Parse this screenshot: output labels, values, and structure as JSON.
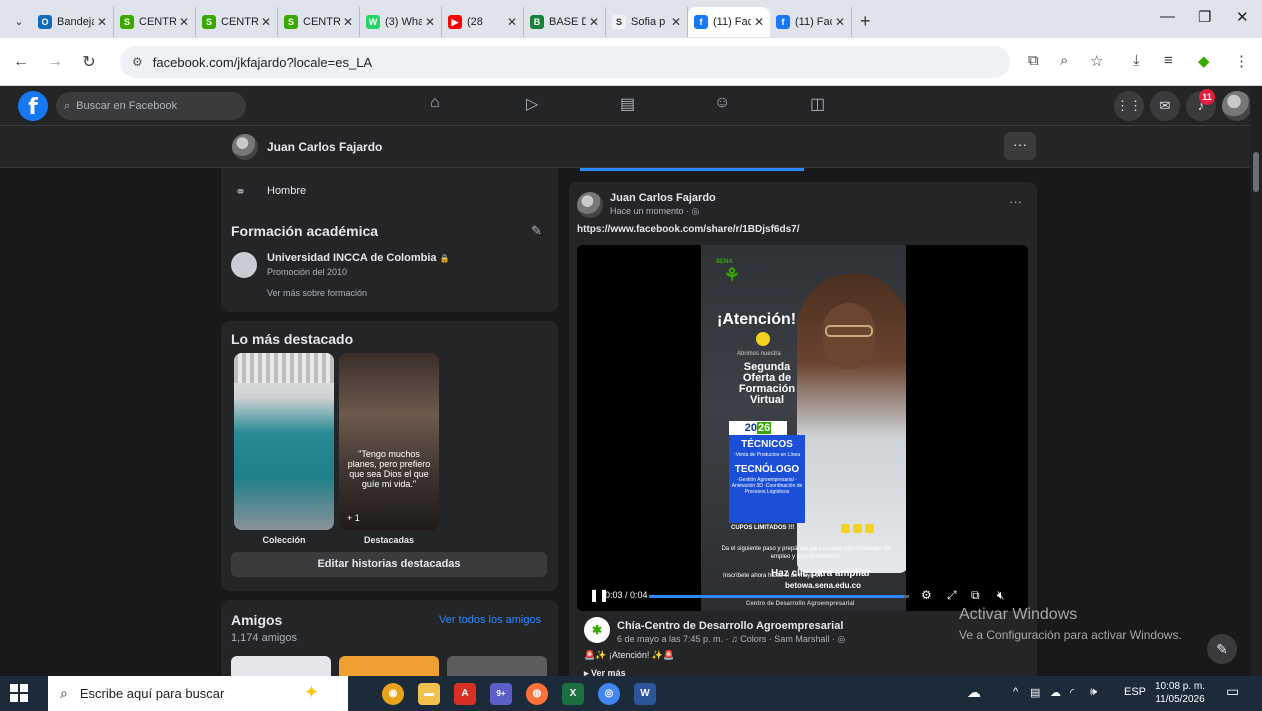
{
  "browser": {
    "tabs": [
      {
        "label": "Bandeja",
        "favicon": "outlook-icon",
        "color": "#0f6cbd",
        "glyph": "O"
      },
      {
        "label": "CENTRO",
        "favicon": "sofia-icon",
        "color": "#39a900",
        "glyph": "S"
      },
      {
        "label": "CENTRO",
        "favicon": "sofia-icon",
        "color": "#39a900",
        "glyph": "S"
      },
      {
        "label": "CENTRO",
        "favicon": "sofia-icon",
        "color": "#39a900",
        "glyph": "S"
      },
      {
        "label": "(3) Wha",
        "favicon": "whatsapp-icon",
        "color": "#25d366",
        "glyph": "W"
      },
      {
        "label": "(28",
        "favicon": "youtube-icon",
        "color": "#ff0000",
        "glyph": "▶"
      },
      {
        "label": "BASE D",
        "favicon": "sheets-icon",
        "color": "#188038",
        "glyph": "B"
      },
      {
        "label": "Sofia p",
        "favicon": "sofiaplus-icon",
        "color": "#f2f2f2",
        "glyph": "S"
      },
      {
        "label": "(11) Fac",
        "favicon": "facebook-icon",
        "color": "#1877f2",
        "glyph": "f",
        "active": true
      },
      {
        "label": "(11) Fac",
        "favicon": "facebook-icon",
        "color": "#1877f2",
        "glyph": "f"
      }
    ],
    "url": "facebook.com/jkfajardo?locale=es_LA"
  },
  "facebook": {
    "search_placeholder": "Buscar en Facebook",
    "notification_count": "11"
  },
  "profile": {
    "name": "Juan Carlos Fajardo",
    "gender": "Hombre"
  },
  "education": {
    "title": "Formación académica",
    "school": "Universidad INCCA de Colombia",
    "lock": "🔒",
    "class_of": "Promoción del 2010",
    "see_more": "Ver más sobre formación"
  },
  "highlights": {
    "title": "Lo más destacado",
    "items": [
      {
        "label": "Colección"
      },
      {
        "label": "Destacadas",
        "quote": "\"Tengo muchos planes, pero prefiero que sea Dios el que guíe mi vida.\"",
        "extra": "+ 1"
      }
    ],
    "edit_button": "Editar historias destacadas"
  },
  "friends": {
    "title": "Amigos",
    "count": "1,174 amigos",
    "see_all": "Ver todos los amigos"
  },
  "post": {
    "author": "Juan Carlos Fajardo",
    "time": "Hace un momento · ",
    "link": "https://www.facebook.com/share/r/1BDjsf6ds7/",
    "video": {
      "time": "0:03 / 0:04",
      "progress": 0.98,
      "flyer": {
        "sena": "SENA",
        "headline": "¡Atención!",
        "abrimos": "Abrimos nuestra",
        "segunda": "Segunda Oferta de Formación Virtual",
        "year_a": "20",
        "year_b": "26",
        "tecnicos": "TÉCNICOS",
        "tecnicos_items": "-Venta de Productos en Línea",
        "tecnologo": "TECNÓLOGO",
        "tecnologo_items": "-Gestión Agroempresarial -Animación 3D -Coordinación de Procesos Logísticos",
        "cupos": "CUPOS LIMITADOS !!!",
        "cta": "Da el siguiente paso y prepárate para nuevas oportunidades de empleo y emprendimiento.",
        "inscribete": "Inscríbete ahora hasta el de mayo en",
        "overlay": "Haz clic para ampliar",
        "site": "betowa.sena.edu.co",
        "centro": "Centro de Desarrollo Agroempresarial"
      }
    },
    "shared_page": "Chía-Centro de Desarrollo Agroempresarial",
    "shared_meta": "6 de mayo a las 7:45 p. m. · ♫ Colors · Sam Marshall · ",
    "shared_text": "🚨✨ ¡Atención! ✨🚨",
    "see_more": "Ver más"
  },
  "watermark": {
    "line1": "Activar Windows",
    "line2": "Ve a Configuración para activar Windows."
  },
  "taskbar": {
    "search": "Escribe aquí para buscar",
    "lang": "ESP",
    "time": "10:08 p. m.",
    "date": "11/05/2026",
    "teams_badge": "9+"
  }
}
